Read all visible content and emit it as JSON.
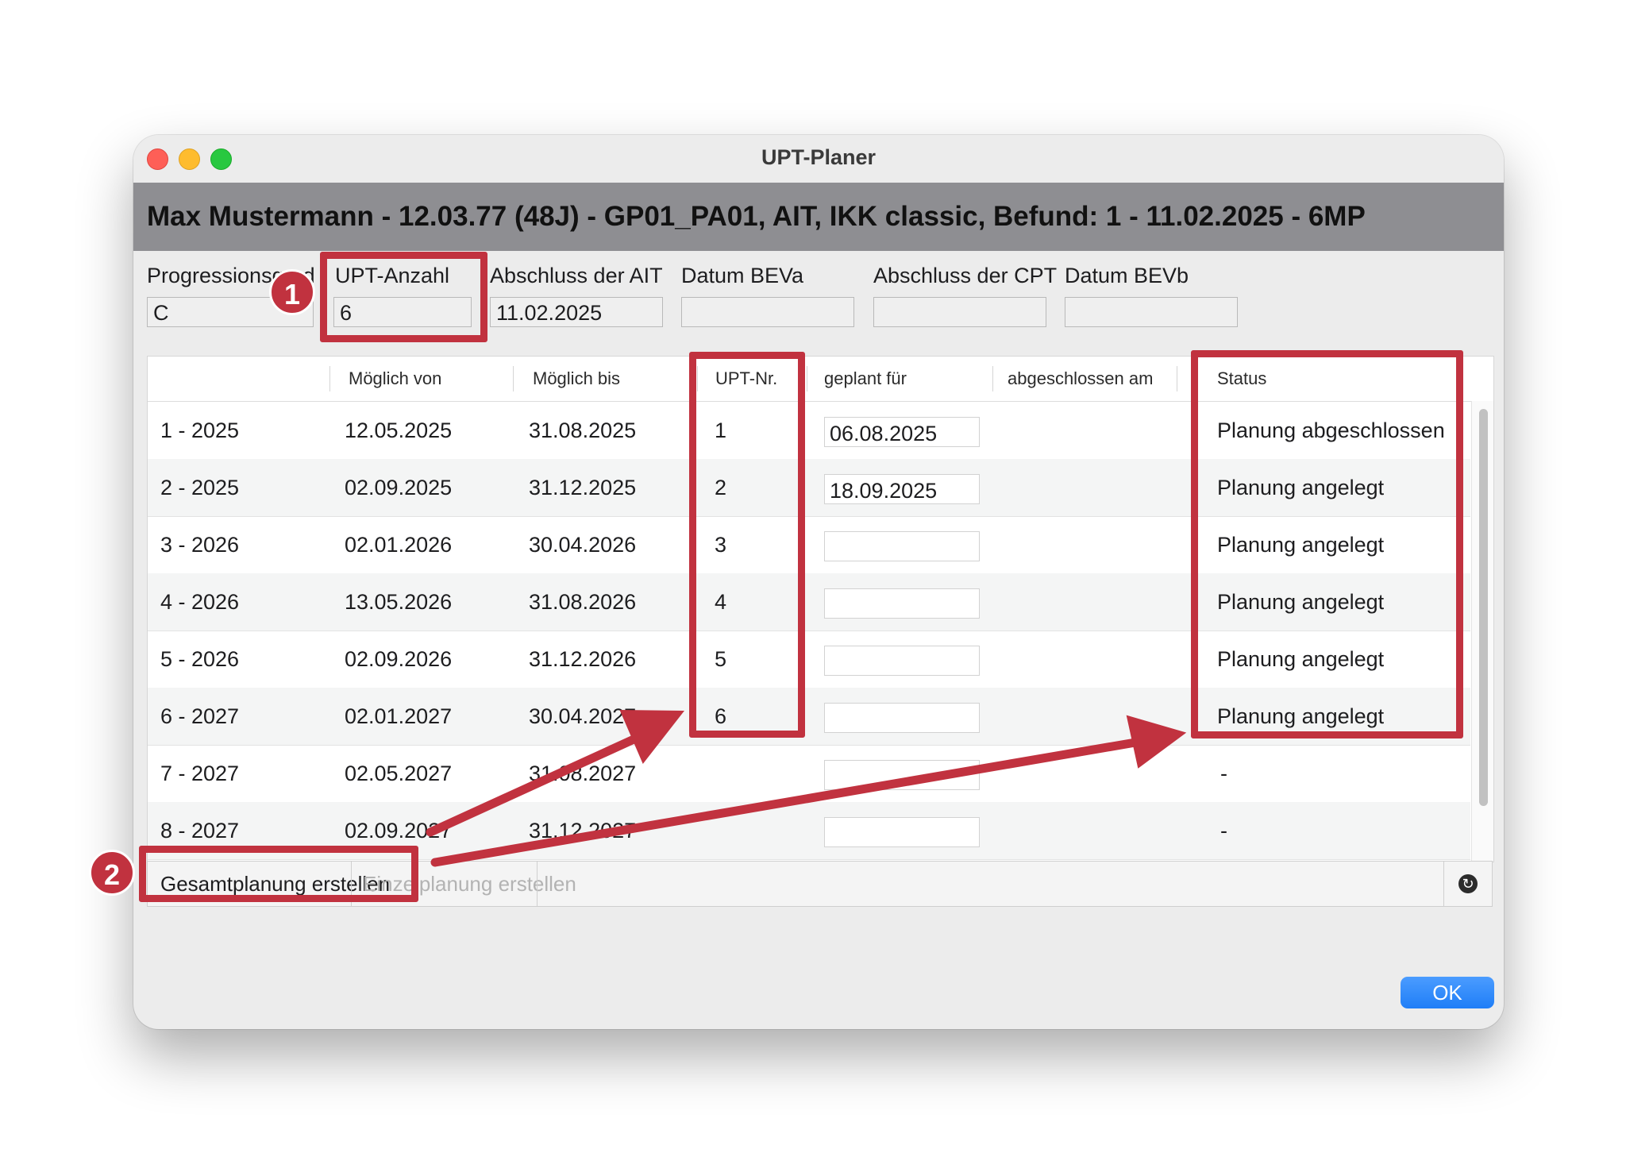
{
  "window": {
    "title": "UPT-Planer"
  },
  "header": {
    "text": "Max Mustermann - 12.03.77 (48J) - GP01_PA01, AIT, IKK classic, Befund: 1 - 11.02.2025 - 6MP"
  },
  "fields": {
    "progressionsgrad": {
      "label": "Progressionsgrad",
      "value": "C"
    },
    "upt_anzahl": {
      "label": "UPT-Anzahl",
      "value": "6"
    },
    "abschluss_ait": {
      "label": "Abschluss der AIT",
      "value": "11.02.2025"
    },
    "datum_beva": {
      "label": "Datum BEVa",
      "value": ""
    },
    "abschluss_cpt": {
      "label": "Abschluss der CPT",
      "value": ""
    },
    "datum_bevb": {
      "label": "Datum BEVb",
      "value": ""
    }
  },
  "table": {
    "columns": [
      "",
      "Möglich von",
      "Möglich bis",
      "UPT-Nr.",
      "geplant für",
      "abgeschlossen am",
      "Status"
    ],
    "rows": [
      {
        "name": "1 - 2025",
        "von": "12.05.2025",
        "bis": "31.08.2025",
        "nr": "1",
        "geplant": "06.08.2025",
        "abgeschlossen": "",
        "status": "Planung abgeschlossen"
      },
      {
        "name": "2 - 2025",
        "von": "02.09.2025",
        "bis": "31.12.2025",
        "nr": "2",
        "geplant": "18.09.2025",
        "abgeschlossen": "",
        "status": "Planung angelegt"
      },
      {
        "name": "3 - 2026",
        "von": "02.01.2026",
        "bis": "30.04.2026",
        "nr": "3",
        "geplant": "",
        "abgeschlossen": "",
        "status": "Planung angelegt"
      },
      {
        "name": "4 - 2026",
        "von": "13.05.2026",
        "bis": "31.08.2026",
        "nr": "4",
        "geplant": "",
        "abgeschlossen": "",
        "status": "Planung angelegt"
      },
      {
        "name": "5 - 2026",
        "von": "02.09.2026",
        "bis": "31.12.2026",
        "nr": "5",
        "geplant": "",
        "abgeschlossen": "",
        "status": "Planung angelegt"
      },
      {
        "name": "6 - 2027",
        "von": "02.01.2027",
        "bis": "30.04.2027",
        "nr": "6",
        "geplant": "",
        "abgeschlossen": "",
        "status": "Planung angelegt"
      },
      {
        "name": "7 - 2027",
        "von": "02.05.2027",
        "bis": "31.08.2027",
        "nr": "",
        "geplant": "",
        "abgeschlossen": "",
        "status": "-"
      },
      {
        "name": "8 - 2027",
        "von": "02.09.2027",
        "bis": "31.12.2027",
        "nr": "",
        "geplant": "",
        "abgeschlossen": "",
        "status": "-"
      }
    ]
  },
  "toolbar": {
    "gesamtplanung_label": "Gesamtplanung erstellen",
    "einzelplanung_label": "Einzelplanung erstellen",
    "refresh_icon": "refresh-icon"
  },
  "buttons": {
    "ok_label": "OK"
  },
  "annotations": {
    "badge_1": "1",
    "badge_2": "2",
    "highlight_color": "#c1323f"
  }
}
